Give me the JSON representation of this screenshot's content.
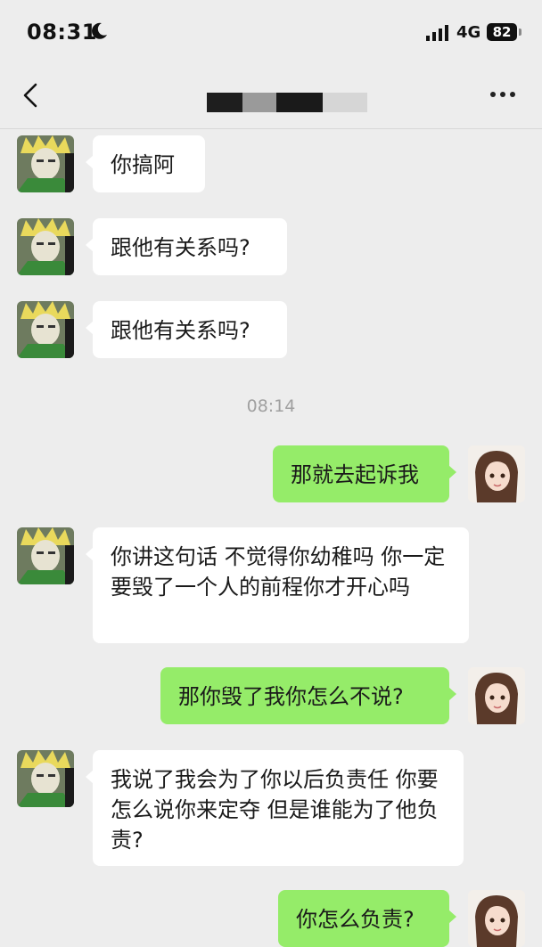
{
  "status_bar": {
    "time": "08:31",
    "network": "4G",
    "battery": "82"
  },
  "nav": {
    "back_icon": "chevron-left-icon",
    "title": "",
    "more_icon": "more-horizontal-icon"
  },
  "messages": [
    {
      "side": "left",
      "text": "你搞阿"
    },
    {
      "side": "left",
      "text": "跟他有关系吗?"
    },
    {
      "side": "left",
      "text": "跟他有关系吗?"
    },
    {
      "side": "right",
      "text": "那就去起诉我"
    },
    {
      "side": "left",
      "text": "你讲这句话 不觉得你幼稚吗 你一定要毁了一个人的前程你才开心吗"
    },
    {
      "side": "right",
      "text": "那你毁了我你怎么不说?"
    },
    {
      "side": "left",
      "text": "我说了我会为了你以后负责任 你要怎么说你来定夺 但是谁能为了他负责?"
    },
    {
      "side": "right",
      "text": "你怎么负责?"
    }
  ],
  "timestamp": "08:14",
  "colors": {
    "background": "#ededed",
    "bubble_self": "#95ec69",
    "bubble_other": "#ffffff"
  }
}
